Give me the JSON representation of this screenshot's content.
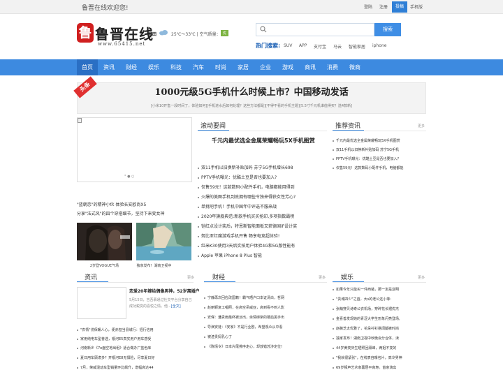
{
  "topbar": {
    "welcome": "鲁晋在线欢迎您!",
    "links": [
      "登陆",
      "注册",
      "投稿",
      "手机版"
    ]
  },
  "brand": {
    "mark": "鲁",
    "name": "鲁晋在线",
    "url": "www.65415.net"
  },
  "weather": {
    "city": "福田",
    "temp": "25℃～33℃",
    "aqi_label": "空气质量：",
    "aqi_value": "优"
  },
  "search": {
    "placeholder": "",
    "button": "搜索",
    "hot_label": "热门搜索:",
    "hot": [
      "SUV",
      "APP",
      "支付宝",
      "马云",
      "智能家居",
      "iphone"
    ]
  },
  "nav": [
    "首页",
    "资讯",
    "财经",
    "娱乐",
    "科技",
    "汽车",
    "时尚",
    "家居",
    "企业",
    "游戏",
    "商讯",
    "消费",
    "微商"
  ],
  "headline": {
    "ribbon": "头条",
    "title": "1000元级5G手机什么时候上市？中国移动发话",
    "sub": "[小米10开售一段时间了，体验如何][手机进水后如何处理？这些方法都是][不得不看的手机主题][5.5寸千元机谁值得买？选4款新]"
  },
  "slider": {
    "dots": "° ● ○"
  },
  "left_list": [
    "\"蓝朝恋\"的精神小伙 体验长安欧尚X5",
    "分享\"法式风\"的四个穿搭细节，坚持下来变女神"
  ],
  "photos": [
    {
      "caption": "2岁登VOGUE气场"
    },
    {
      "caption": "独家发布！湖南卫视中"
    }
  ],
  "roll": {
    "title": "滚动要闻",
    "more": "",
    "headline": "千元内最优选全金属荣耀畅玩5X手机图赏",
    "items": [
      "双11手机以旧换新补贴加码 苏宁5G手机增长698",
      "PPTV手机曝光：优酷土豆是否也要加入?",
      "仅售59元！这款数码小配件手机，电脑都能用得到",
      "火爆的美图手机到底拥有哪些令独来得获女性芳心?",
      "单挑吧手机！手机中国年中评选不服来战",
      "2020年旗舰典范:新款手机买买抢印,多项指数霸榜",
      "铠红点设计奖后，特恩斯智能面板又获德国iF设计奖",
      "努比亚红魔游戏手机开售 畅享电竞超体验!",
      "红米K30使用3天后实拍用户体验4G和5G版性能有",
      "Apple 苹果 iPhone 8 Plus 智能"
    ]
  },
  "recommend": {
    "title": "推荐资讯",
    "more": "更多",
    "items": [
      "千元内最优选全金属荣耀畅玩5X手机图赏",
      "双11手机以旧换新补贴加码 苏宁5G手机",
      "PPTV手机曝光：优酷土豆是否也要加入?",
      "仅售59元！这款数码小配件手机，电脑都能"
    ]
  },
  "news": {
    "title": "资讯",
    "more": "更多",
    "feature_title": "恋爱20年嫁给偶像男神，52岁离婚户",
    "feature_summary": "5月15日，吉吾慕通过社交平台分享自己成功蜕变的喜悦之情。他...",
    "readmore": "[全文]",
    "items": [
      "\"农情\"涝保暖人心，便赤担当县城行：招行信用",
      "家用纯电车型普选，银河E5真实用户用车感受",
      "河南新乡《7o面空地出租》适合做办厂蓝色库",
      "夏日用车顾虑多？开银河E8无惧险，尽享夏日好",
      "7月，荣威混动车型销量环比飙升，增幅高达44"
    ]
  },
  "finance": {
    "title": "财经",
    "more": "更多",
    "items": [
      "宁静再次回应改国籍！霸气晒户口本证清白，哲网",
      "赵丽颖复工唱照，在高空吊威亚，高到看不到人影",
      "安保：潘贵雨最终被淡出，余情绑架的幕后黑手出",
      "导演安徒：《安家》不是行业剧，希望观众从中看",
      "被渣贵妈乳心了",
      "《陈情令》日本片尾排序走心，却放错苏涉定位!"
    ]
  },
  "ent": {
    "title": "娱乐",
    "more": "更多",
    "items": [
      "如果今年只能买一件西装，那一定是这明",
      "\"贵城四少\"之首，大s的老公还小菲:",
      "张萌穿贝诗奇公衣机场，穿碎花长裙优杰",
      "金喜善发现她的青涩大学生形象闪亮登场,",
      "赵薇芝太优雅了，花朵衬衫搭阔腿裤时尚",
      "独家发布！湖南卫视中秋晚会分合体，渎",
      "44岁黄奕庆生晒照回顾峰，两姐不变的",
      "\"我就很紧张\"，在线表自曝名片，高冷男神",
      "69岁相声艺术家薯居平高寿。首亲演出"
    ]
  }
}
